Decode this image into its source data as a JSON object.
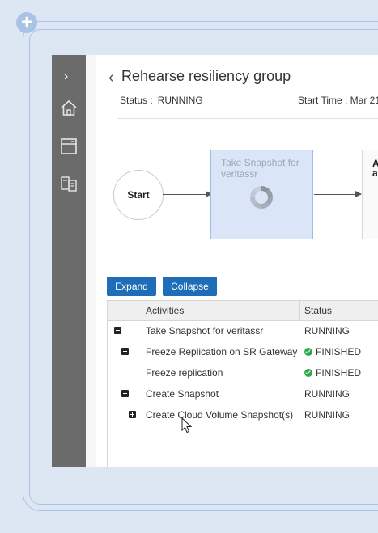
{
  "page": {
    "title": "Rehearse resiliency group",
    "status_label": "Status :",
    "status_value": "RUNNING",
    "start_time_label": "Start Time : Mar 21,"
  },
  "sidebar": {
    "items": [
      {
        "icon": "chevron-right-icon"
      },
      {
        "icon": "home-icon"
      },
      {
        "icon": "window-icon"
      },
      {
        "icon": "server-icon"
      }
    ]
  },
  "workflow": {
    "start_label": "Start",
    "task_label_line1": "Take Snapshot for",
    "task_label_line2": "veritassr",
    "next_label_line1": "A",
    "next_label_line2": "a"
  },
  "actions": {
    "expand_label": "Expand",
    "collapse_label": "Collapse"
  },
  "table": {
    "columns": [
      "Activities",
      "Status"
    ],
    "rows": [
      {
        "activity": "Take Snapshot for veritassr",
        "status": "RUNNING",
        "toggle": "collapse"
      },
      {
        "activity": "Freeze Replication on SR Gateway",
        "status": "FINISHED",
        "toggle": "collapse"
      },
      {
        "activity": "Freeze replication",
        "status": "FINISHED",
        "toggle": "none"
      },
      {
        "activity": "Create Snapshot",
        "status": "RUNNING",
        "toggle": "collapse"
      },
      {
        "activity": "Create Cloud Volume Snapshot(s)",
        "status": "RUNNING",
        "toggle": "expand"
      }
    ]
  },
  "colors": {
    "accent": "#1e6db6",
    "success": "#2ba84a",
    "rail": "#6b6b6b"
  }
}
